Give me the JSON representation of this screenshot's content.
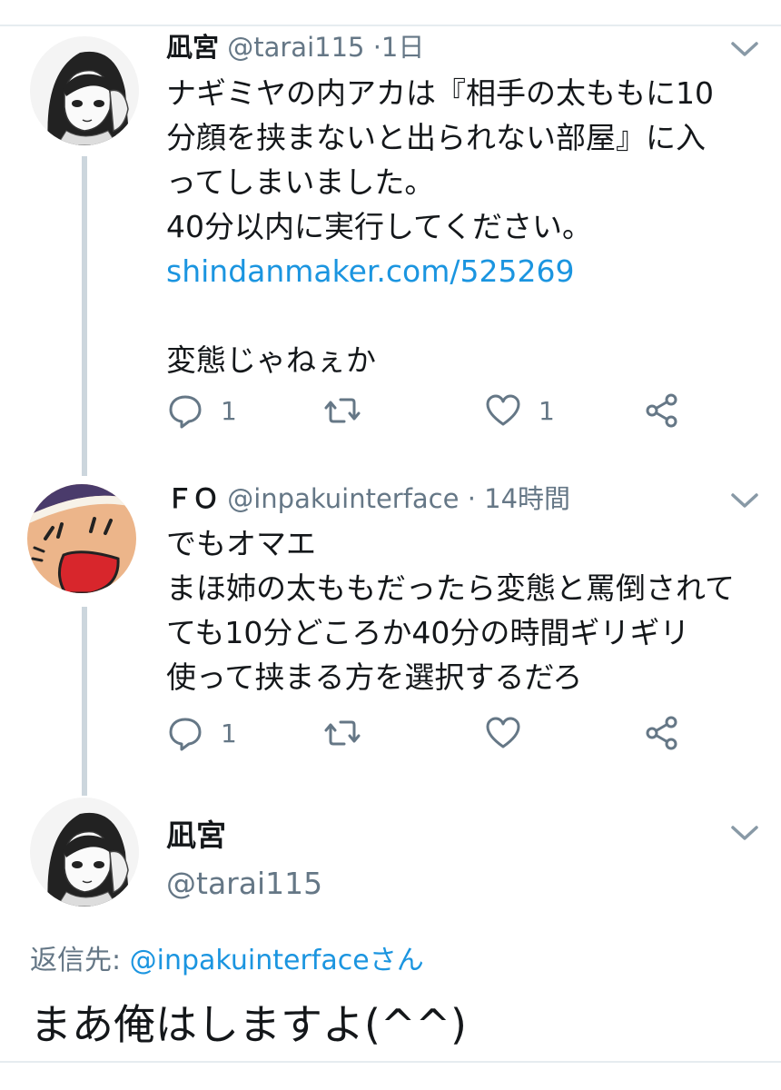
{
  "colors": {
    "text": "#14171a",
    "muted": "#657786",
    "link": "#1b95e0",
    "thread_line": "#ccd6dd"
  },
  "tweets": [
    {
      "avatar": "manga-girl-avatar",
      "name": "凪宮",
      "handle": "@tarai115",
      "separator": "·",
      "time": "1日",
      "lines": [
        "ナギミヤの内アカは『相手の太ももに10",
        "分顔を挟まないと出られない部屋』に入",
        "ってしまいました。",
        "40分以内に実行してください。"
      ],
      "link": "shindanmaker.com/525269",
      "comment": "変態じゃねぇか",
      "reply_count": "1",
      "retweet_count": "",
      "like_count": "1"
    },
    {
      "avatar": "cartoon-face-avatar",
      "name": "ＦＯ",
      "handle": "@inpakuinterface",
      "separator": "·",
      "time": "14時間",
      "lines": [
        "でもオマエ",
        "まほ姉の太ももだったら変態と罵倒されて",
        "ても10分どころか40分の時間ギリギリ",
        "使って挟まる方を選択するだろ"
      ],
      "reply_count": "1",
      "retweet_count": "",
      "like_count": ""
    }
  ],
  "focused_tweet": {
    "avatar": "manga-girl-avatar",
    "name": "凪宮",
    "handle": "@tarai115",
    "replying_label": "返信先:",
    "replying_mention": "@inpakuinterfaceさん",
    "text": "まあ俺はしますよ(^^)"
  }
}
